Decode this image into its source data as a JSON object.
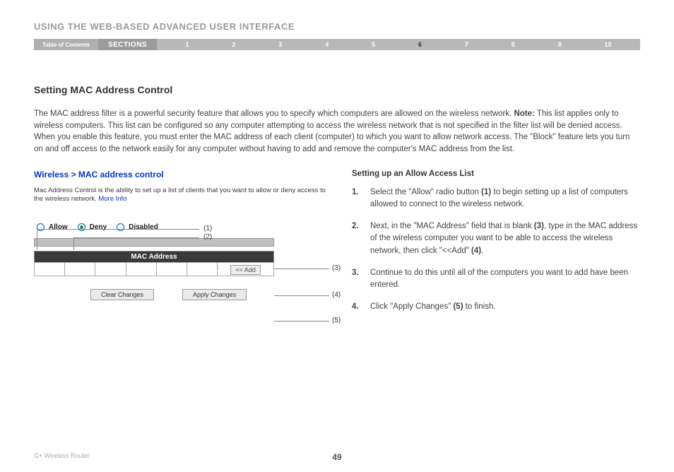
{
  "chapter_title": "USING THE WEB-BASED ADVANCED USER INTERFACE",
  "nav": {
    "toc": "Table of Contents",
    "sections": "SECTIONS",
    "nums": [
      "1",
      "2",
      "3",
      "4",
      "5",
      "6",
      "7",
      "8",
      "9",
      "10"
    ],
    "active": "6"
  },
  "section_title": "Setting MAC Address Control",
  "intro": {
    "text_before_note": "The MAC address filter is a powerful security feature that allows you to specify which computers are allowed on the wireless network. ",
    "note_label": "Note:",
    "text_after_note": " This list applies only to wireless computers. This list can be configured so any computer attempting to access the wireless network that is not specified in the filter list will be denied access. When you enable this feature, you must enter the MAC address of each client (computer) to which you want to allow network access. The \"Block\" feature lets you turn on and off access to the network easily for any computer without having to add and remove the computer's MAC address from the list."
  },
  "ui": {
    "breadcrumb": "Wireless > MAC address control",
    "desc": "Mac Address Control is the ability to set up a list of clients that you want to allow or deny access to the wireless network. ",
    "more_info": "More Info",
    "radios": {
      "allow": "Allow",
      "deny": "Deny",
      "disabled": "Disabled"
    },
    "mac_header": "MAC Address",
    "add_btn": "<< Add",
    "clear_btn": "Clear Changes",
    "apply_btn": "Apply Changes",
    "callouts": {
      "c1": "(1)",
      "c2": "(2)",
      "c3": "(3)",
      "c4": "(4)",
      "c5": "(5)"
    }
  },
  "right": {
    "heading": "Setting up an Allow Access List",
    "steps": [
      {
        "num": "1.",
        "pre": "Select the \"Allow\" radio button ",
        "bold": "(1)",
        "post": " to begin setting up a list of computers allowed to connect to the wireless network."
      },
      {
        "num": "2.",
        "pre": "Next, in the \"MAC Address\" field that is blank ",
        "bold": "(3)",
        "mid": ", type in the MAC address of the wireless computer you want to be able to access the wireless network, then click \"<<Add\" ",
        "bold2": "(4)",
        "post": "."
      },
      {
        "num": "3.",
        "pre": "Continue to do this until all of the computers you want to add have been entered.",
        "bold": "",
        "post": ""
      },
      {
        "num": "4.",
        "pre": "Click \"Apply Changes\" ",
        "bold": "(5)",
        "post": " to finish."
      }
    ]
  },
  "footer": {
    "product": "G+ Wireless Router",
    "page": "49"
  }
}
